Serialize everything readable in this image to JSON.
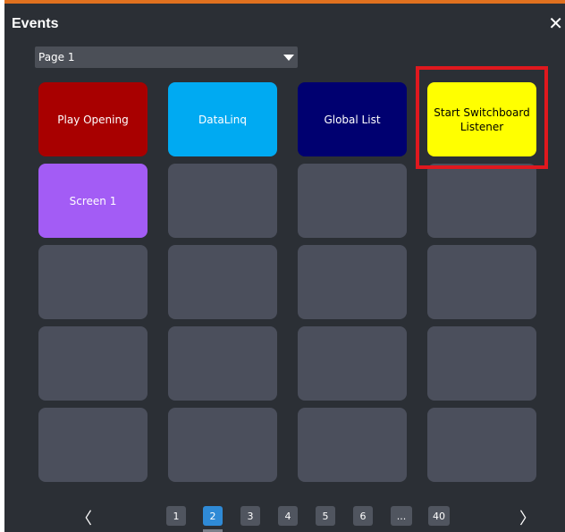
{
  "window": {
    "title": "Events",
    "close_glyph": "✕"
  },
  "page_select": {
    "value": "Page 1"
  },
  "tiles": [
    {
      "label": "Play Opening",
      "color": "#a80000",
      "text_color": "#ffffff"
    },
    {
      "label": "DataLinq",
      "color": "#00aaf2",
      "text_color": "#ffffff"
    },
    {
      "label": "Global List",
      "color": "#000070",
      "text_color": "#ffffff"
    },
    {
      "label": "Start Switchboard Listener",
      "color": "#ffff00",
      "text_color": "#000000"
    },
    {
      "label": "Screen 1",
      "color": "#a35cf5",
      "text_color": "#ffffff"
    },
    {
      "label": "",
      "color": "#4b4f5c"
    },
    {
      "label": "",
      "color": "#4b4f5c"
    },
    {
      "label": "",
      "color": "#4b4f5c"
    },
    {
      "label": "",
      "color": "#4b4f5c"
    },
    {
      "label": "",
      "color": "#4b4f5c"
    },
    {
      "label": "",
      "color": "#4b4f5c"
    },
    {
      "label": "",
      "color": "#4b4f5c"
    },
    {
      "label": "",
      "color": "#4b4f5c"
    },
    {
      "label": "",
      "color": "#4b4f5c"
    },
    {
      "label": "",
      "color": "#4b4f5c"
    },
    {
      "label": "",
      "color": "#4b4f5c"
    },
    {
      "label": "",
      "color": "#4b4f5c"
    },
    {
      "label": "",
      "color": "#4b4f5c"
    },
    {
      "label": "",
      "color": "#4b4f5c"
    },
    {
      "label": "",
      "color": "#4b4f5c"
    }
  ],
  "pagination": {
    "prev_glyph": "〈",
    "next_glyph": "〉",
    "pages": [
      "1",
      "2",
      "3",
      "4",
      "5",
      "6",
      "...",
      "40"
    ],
    "active_page": "2"
  },
  "colors": {
    "accent": "#e0711f",
    "highlight_box": "#e0181e",
    "active_page": "#2f8ad6"
  }
}
